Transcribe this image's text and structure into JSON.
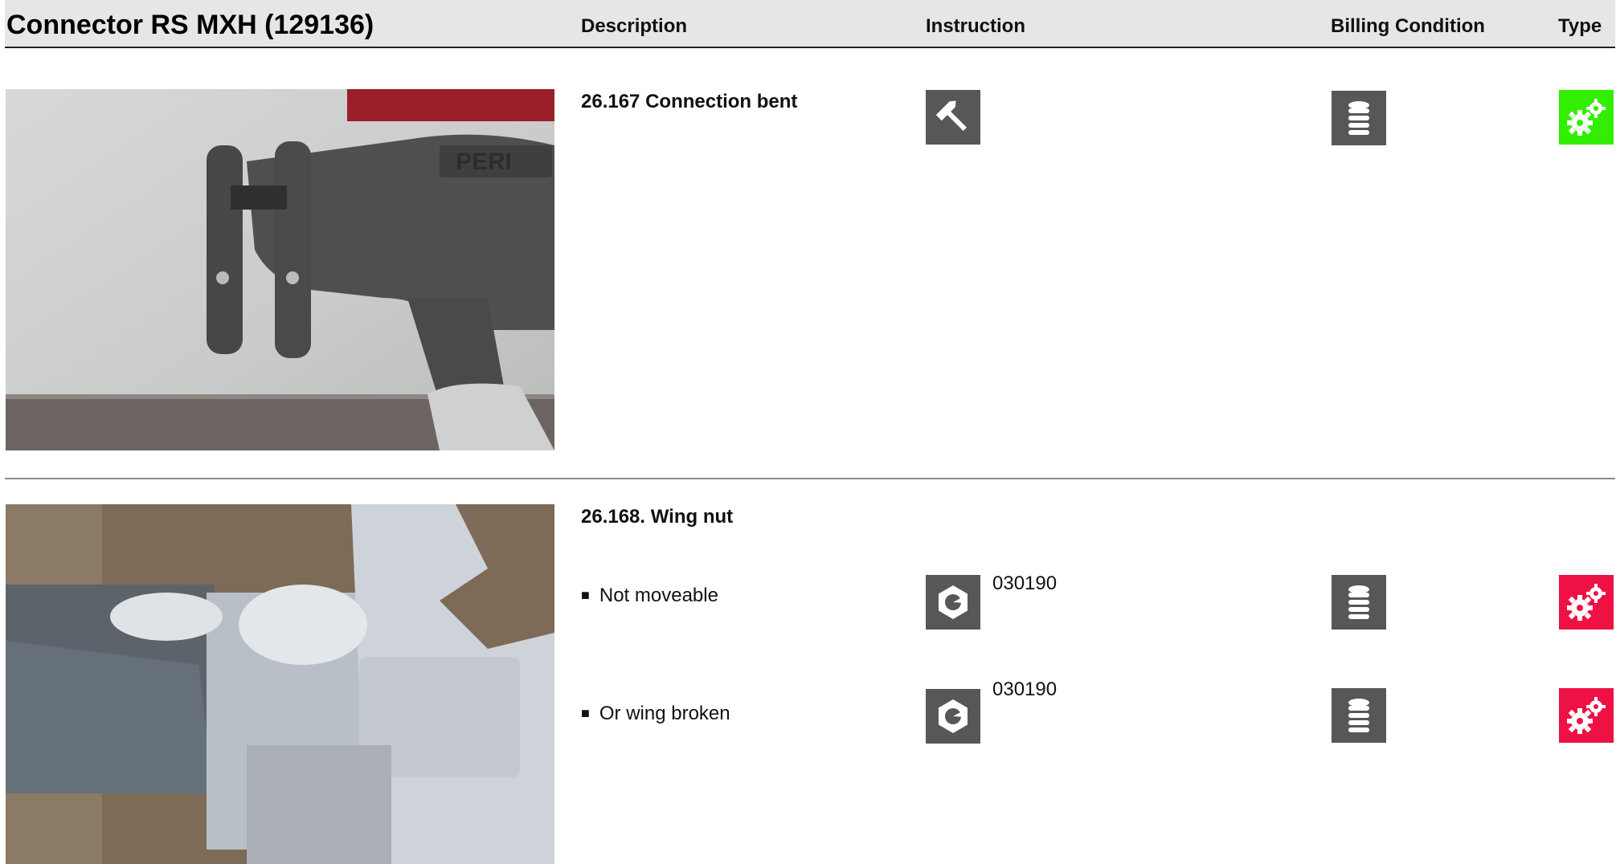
{
  "header": {
    "title": "Connector RS MXH (129136)",
    "columns": {
      "description": "Description",
      "instruction": "Instruction",
      "billing": "Billing Condition",
      "type": "Type"
    }
  },
  "entries": [
    {
      "title": "26.167 Connection bent",
      "instruction_icon": "hammer-icon",
      "billing_icon": "coin-stack-icon",
      "type_icon": "gears-icon",
      "type_color": "#33ee00"
    },
    {
      "title": "26.168. Wing nut",
      "items": [
        {
          "label": "Not moveable",
          "instruction_icon": "nut-icon",
          "code": "030190",
          "billing_icon": "coin-stack-icon",
          "type_icon": "gears-icon",
          "type_color": "#ee1144"
        },
        {
          "label": "Or wing broken",
          "instruction_icon": "nut-icon",
          "code": "030190",
          "billing_icon": "coin-stack-icon",
          "type_icon": "gears-icon",
          "type_color": "#ee1144"
        }
      ]
    }
  ],
  "colors": {
    "icon_grey": "#555759",
    "header_bg": "#e6e6e6"
  }
}
